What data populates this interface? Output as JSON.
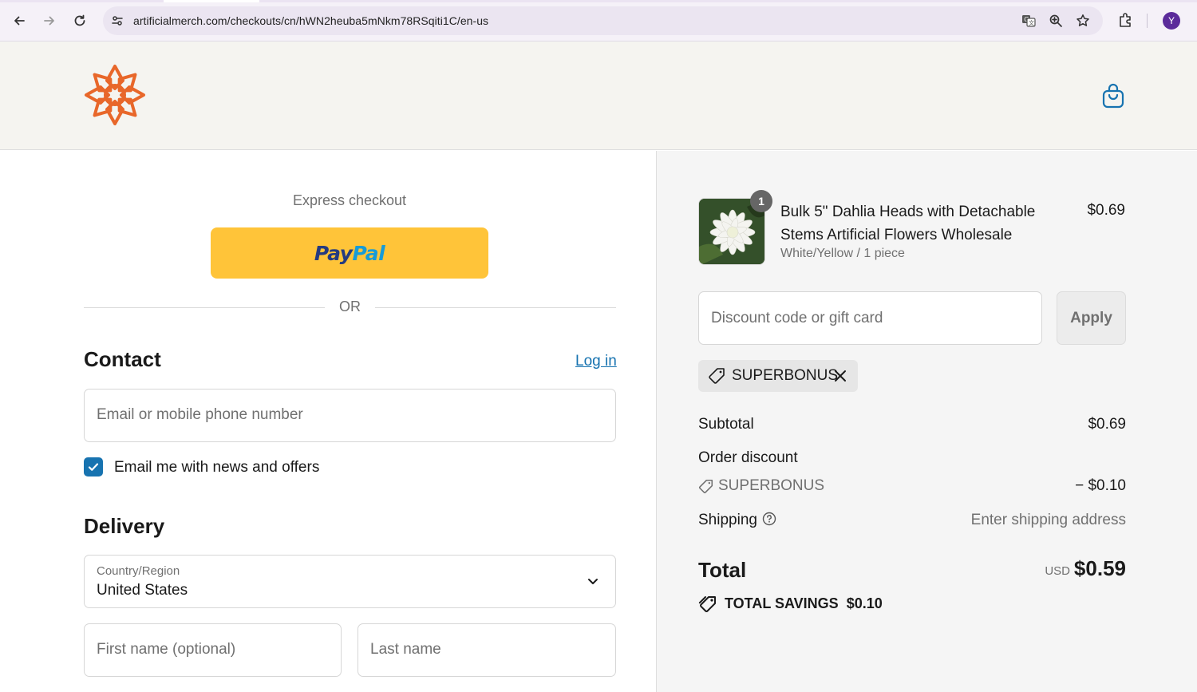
{
  "browser": {
    "url": "artificialmerch.com/checkouts/cn/hWN2heuba5mNkm78RSqiti1C/en-us",
    "profile_initial": "Y"
  },
  "checkout": {
    "express_title": "Express checkout",
    "paypal": {
      "pay": "Pay",
      "pal": "Pal"
    },
    "or_label": "OR",
    "contact": {
      "title": "Contact",
      "login_link": "Log in",
      "email_placeholder": "Email or mobile phone number",
      "newsletter_label": "Email me with news and offers",
      "newsletter_checked": true
    },
    "delivery": {
      "title": "Delivery",
      "country_label": "Country/Region",
      "country_value": "United States",
      "first_name_placeholder": "First name (optional)",
      "last_name_placeholder": "Last name"
    }
  },
  "summary": {
    "item": {
      "quantity": "1",
      "name": "Bulk 5\" Dahlia Heads with Detachable Stems Artificial Flowers Wholesale",
      "variant": "White/Yellow / 1 piece",
      "price": "$0.69"
    },
    "discount_placeholder": "Discount code or gift card",
    "apply_label": "Apply",
    "applied_code": "SUPERBONUS",
    "subtotal_label": "Subtotal",
    "subtotal_value": "$0.69",
    "order_discount_label": "Order discount",
    "order_discount_code": "SUPERBONUS",
    "order_discount_value": "− $0.10",
    "shipping_label": "Shipping",
    "shipping_value": "Enter shipping address",
    "total_label": "Total",
    "currency": "USD",
    "total_value": "$0.59",
    "savings_label": "TOTAL SAVINGS",
    "savings_value": "$0.10"
  },
  "colors": {
    "brand_orange": "#e8672a",
    "link_blue": "#1773b0",
    "paypal_yellow": "#ffc439"
  }
}
